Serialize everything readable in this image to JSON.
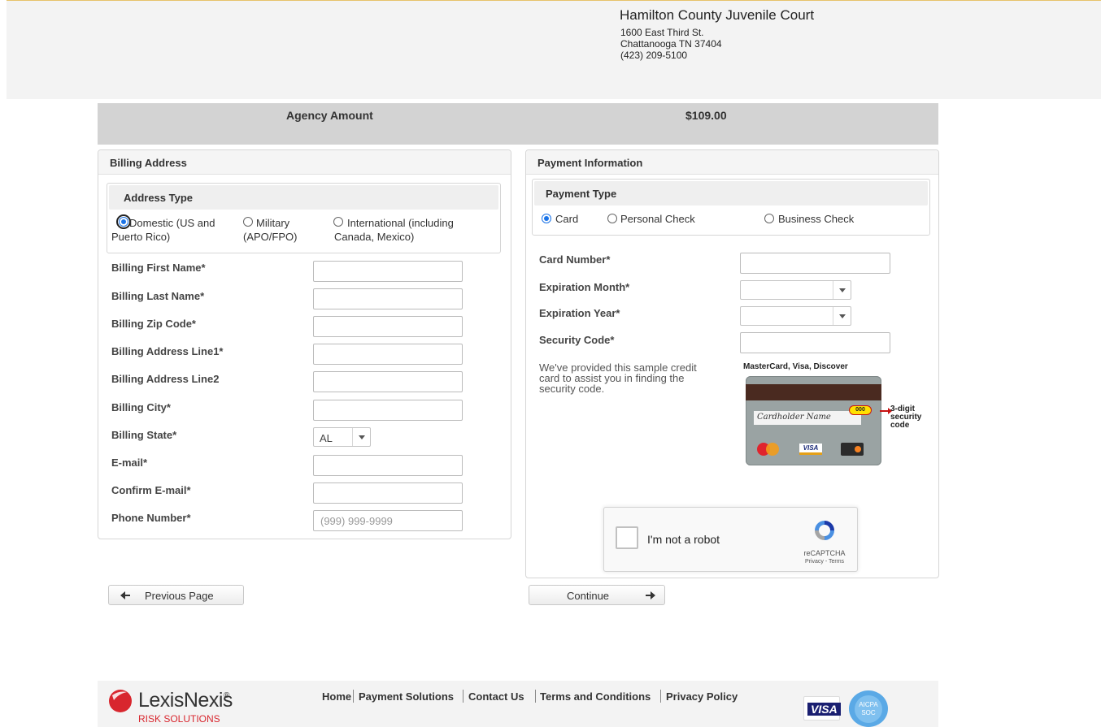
{
  "header": {
    "court_name": "Hamilton County Juvenile Court",
    "address_line1": "1600 East Third St.",
    "address_line2": "Chattanooga TN 37404",
    "phone": "(423) 209-5100"
  },
  "agency": {
    "label": "Agency Amount",
    "amount": "$109.00"
  },
  "billing": {
    "title": "Billing Address",
    "address_type": {
      "title": "Address Type",
      "options": [
        {
          "line1": "Domestic (US and",
          "line2": "Puerto Rico)",
          "selected": true
        },
        {
          "line1": "Military",
          "line2": "(APO/FPO)",
          "selected": false
        },
        {
          "line1": "International (including",
          "line2": "Canada, Mexico)",
          "selected": false
        }
      ]
    },
    "fields": [
      {
        "label": "Billing First Name*",
        "value": "",
        "placeholder": ""
      },
      {
        "label": "Billing Last Name*",
        "value": "",
        "placeholder": ""
      },
      {
        "label": "Billing Zip Code*",
        "value": "",
        "placeholder": ""
      },
      {
        "label": "Billing Address Line1*",
        "value": "",
        "placeholder": ""
      },
      {
        "label": "Billing Address Line2",
        "value": "",
        "placeholder": ""
      },
      {
        "label": "Billing City*",
        "value": "",
        "placeholder": ""
      },
      {
        "label": "Billing State*",
        "value": "AL",
        "placeholder": ""
      },
      {
        "label": "E-mail*",
        "value": "",
        "placeholder": ""
      },
      {
        "label": "Confirm E-mail*",
        "value": "",
        "placeholder": ""
      },
      {
        "label": "Phone Number*",
        "value": "",
        "placeholder": "(999) 999-9999"
      }
    ]
  },
  "payment": {
    "title": "Payment Information",
    "payment_type": {
      "title": "Payment Type",
      "options": [
        {
          "label": "Card",
          "selected": true
        },
        {
          "label": "Personal Check",
          "selected": false
        },
        {
          "label": "Business Check",
          "selected": false
        }
      ]
    },
    "fields": [
      {
        "label": "Card Number*",
        "value": ""
      },
      {
        "label": "Expiration Month*",
        "value": ""
      },
      {
        "label": "Expiration Year*",
        "value": ""
      },
      {
        "label": "Security Code*",
        "value": ""
      }
    ],
    "help_lines": [
      "We've provided this sample credit",
      "card to assist you in finding the",
      "security code."
    ],
    "card_sample": {
      "brands_label": "MasterCard,  Visa,  Discover",
      "signature": "Cardholder Name",
      "code": "000",
      "code_note": "3-digit security code",
      "visa_mark": "VISA"
    },
    "captcha": {
      "label": "I'm not a robot",
      "brand": "reCAPTCHA",
      "links": "Privacy - Terms"
    }
  },
  "buttons": {
    "previous": "Previous Page",
    "continue": "Continue"
  },
  "footer": {
    "brand": "LexisNexis",
    "brand_mark": "®",
    "sub": "RISK SOLUTIONS",
    "links": [
      "Home",
      "Payment Solutions",
      "Contact Us",
      "Terms and Conditions",
      "Privacy Policy"
    ],
    "visa": "VISA",
    "aicpa": "AICPA SOC"
  },
  "colors": {
    "accent_blue": "#1a73e8",
    "lexis_red": "#d8262e",
    "visa_blue": "#1a1f71"
  }
}
